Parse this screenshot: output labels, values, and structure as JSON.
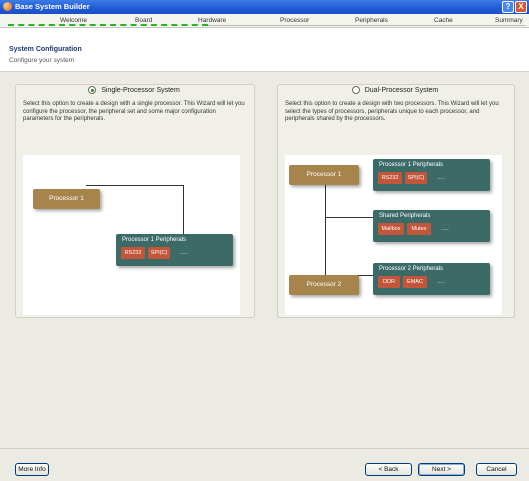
{
  "window": {
    "title": "Base System Builder",
    "help_label": "?",
    "close_label": "X"
  },
  "steps": [
    "Welcome",
    "Board",
    "Hardware",
    "Processor",
    "Peripherals",
    "Cache",
    "Summary"
  ],
  "header": {
    "title": "System Configuration",
    "subtitle": "Configure your system"
  },
  "single": {
    "label": "Single-Processor System",
    "selected": true,
    "description": "Select this option to create a design with a single processor. This Wizard will let you configure the processor, the peripheral set and some major configuration parameters for the peripherals.",
    "processor": "Processor 1",
    "peripherals_title": "Processor 1 Peripherals",
    "chips": [
      "RS232",
      "SPI(C)",
      "....."
    ]
  },
  "dual": {
    "label": "Dual-Processor System",
    "selected": false,
    "description": "Select this option to create a design with two processors. This Wizard will let you select the types of processors, peripherals unique to each processor, and peripherals shared by the processors.",
    "processor1": "Processor 1",
    "processor2": "Processor 2",
    "p1_peripherals_title": "Processor 1 Peripherals",
    "p1_chips": [
      "RS232",
      "SPI(C)",
      "....."
    ],
    "shared_title": "Shared Peripherals",
    "shared_chips": [
      "Mailbox",
      "Mutex",
      "....."
    ],
    "p2_peripherals_title": "Processor 2 Peripherals",
    "p2_chips": [
      "DDR",
      "EMAC",
      "....."
    ]
  },
  "buttons": {
    "more_info": "More Info",
    "back": "< Back",
    "next": "Next >",
    "cancel": "Cancel"
  }
}
